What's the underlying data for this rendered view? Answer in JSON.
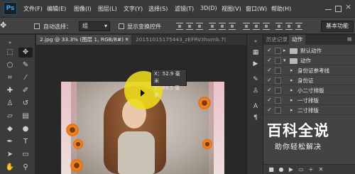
{
  "app": {
    "logo": "Ps"
  },
  "menubar": {
    "items": [
      "文件(F)",
      "编辑(E)",
      "图像(I)",
      "图层(L)",
      "文字(Y)",
      "选择(S)",
      "滤镜(T)",
      "3D(D)",
      "视图(V)",
      "窗口(W)",
      "帮助(H)"
    ]
  },
  "options_bar": {
    "tool_preset": "✥",
    "auto_select_label": "自动选择：",
    "auto_select_value": "组",
    "show_transform_label": "显示变换控件",
    "workspace": "基本功能"
  },
  "tabs": [
    {
      "label": "2.jpg @ 33.3% (图层 1, RGB/8#) *",
      "close": "×"
    },
    {
      "label": "20151015175443_zEFRV.thumb.7(",
      "close": ""
    }
  ],
  "coord_tooltip": {
    "x_label": "X：",
    "x_value": "52.9 毫米",
    "y_label": "Y：",
    "y_value": "88.5 毫米"
  },
  "panel": {
    "tabs": [
      "历史记录",
      "动作"
    ],
    "menu_icon": "≡",
    "actions": [
      {
        "check": "✓",
        "arrow": "▸",
        "label": "默认动作",
        "level": 0,
        "folder": true
      },
      {
        "check": "✓",
        "arrow": "▾",
        "label": "动作",
        "level": 0,
        "folder": true
      },
      {
        "check": "✓",
        "arrow": "▸",
        "label": "身份证参考线",
        "level": 1,
        "folder": false
      },
      {
        "check": "✓",
        "arrow": "▸",
        "label": "身份证",
        "level": 1,
        "folder": false
      },
      {
        "check": "✓",
        "arrow": "▸",
        "label": "小二寸排版",
        "level": 1,
        "folder": false
      },
      {
        "check": "✓",
        "arrow": "▸",
        "label": "一寸排版",
        "level": 1,
        "folder": false
      },
      {
        "check": "✓",
        "arrow": "▸",
        "label": "二寸排版",
        "level": 1,
        "folder": false
      }
    ]
  },
  "watermark": {
    "title": "百科全说",
    "subtitle": "助你轻松解决"
  },
  "colors": {
    "cursor_highlight": "#eedc19",
    "ui_dark": "#282828",
    "panel": "#434343"
  }
}
